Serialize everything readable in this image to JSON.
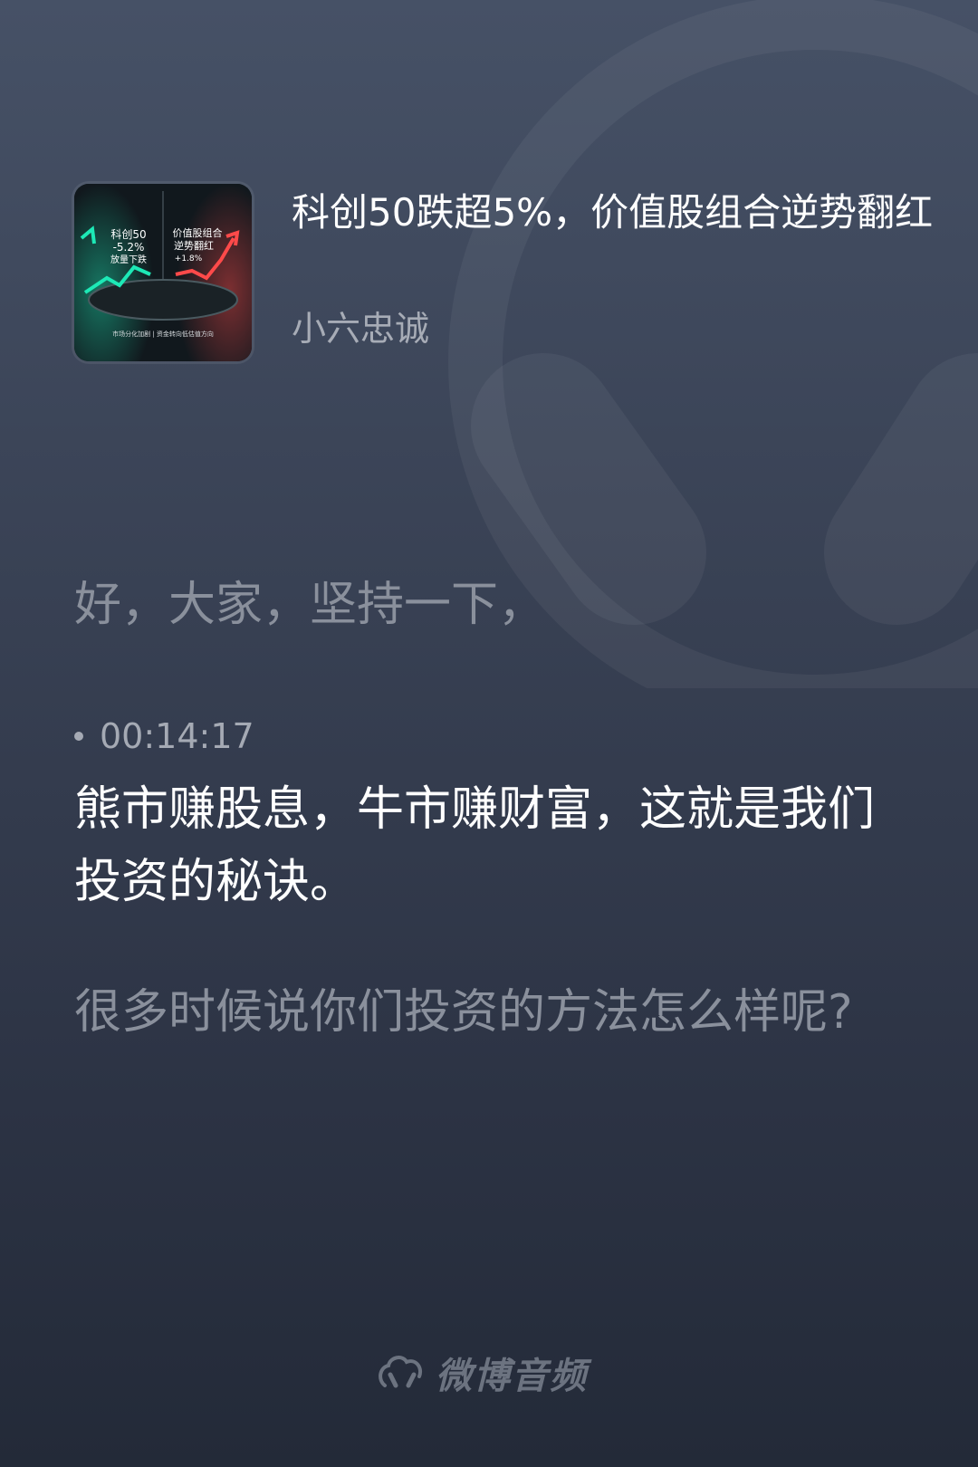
{
  "track": {
    "title": "科创50跌超5%，价值股组合逆势翻红",
    "author": "小六忠诚",
    "cover": {
      "left_label_line1": "科创50",
      "left_label_line2": "-5.2%",
      "left_label_line3": "放量下跌",
      "right_label_line1": "价值股组合",
      "right_label_line2": "逆势翻红",
      "right_label_line3": "+1.8%",
      "caption": "市场分化加剧 | 资金转向低估值方向"
    }
  },
  "lyrics": {
    "previous": "好，大家，坚持一下，",
    "timestamp": "00:14:17",
    "current": "熊市赚股息，牛市赚财富，这就是我们投资的秘诀。",
    "next": "很多时候说你们投资的方法怎么样呢?"
  },
  "brand": {
    "name": "微博音频"
  },
  "colors": {
    "background_top": "#465166",
    "background_bottom": "#232a38",
    "text_active": "#ffffff",
    "text_inactive": "#8a909c",
    "cover_green": "#1de9b6",
    "cover_red": "#ff4a4a"
  }
}
